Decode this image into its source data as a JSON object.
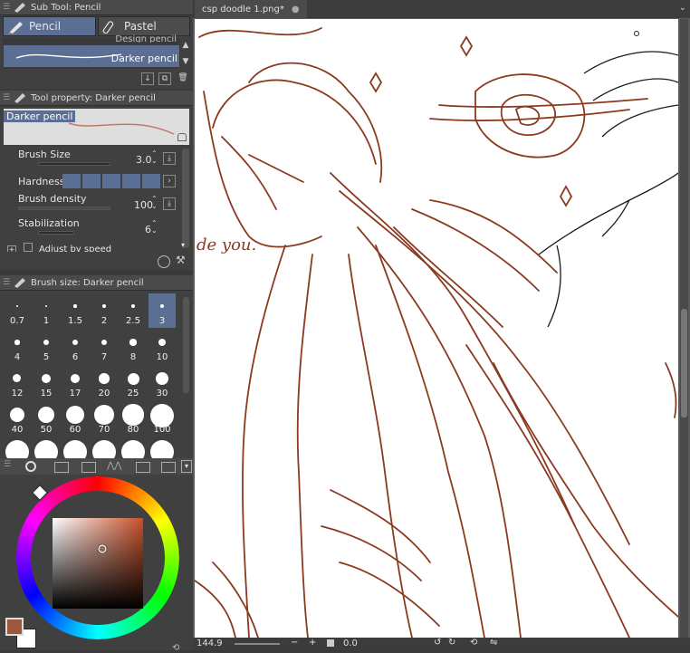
{
  "sub_tool": {
    "title": "Sub Tool: Pencil",
    "tabs": [
      "Pencil",
      "Pastel"
    ],
    "partial_item": "Design pencil",
    "selected_item": "Darker pencil"
  },
  "tool_property": {
    "title": "Tool property: Darker pencil",
    "preview_label": "Darker pencil",
    "brush_size_label": "Brush Size",
    "brush_size_value": "3.0",
    "hardness_label": "Hardness",
    "brush_density_label": "Brush density",
    "brush_density_value": "100",
    "stabilization_label": "Stabilization",
    "stabilization_value": "6",
    "adjust_label": "Adjust by speed"
  },
  "brush_size_panel": {
    "title": "Brush size: Darker pencil",
    "sizes": [
      "0.7",
      "1",
      "1.5",
      "2",
      "2.5",
      "3",
      "4",
      "5",
      "6",
      "7",
      "8",
      "10",
      "12",
      "15",
      "17",
      "20",
      "25",
      "30",
      "40",
      "50",
      "60",
      "70",
      "80",
      "100",
      "",
      "",
      "",
      "",
      "",
      ""
    ],
    "selected": "3"
  },
  "color": {
    "main_color": "#a0553e",
    "sub_color": "#ffffff",
    "picker_hue": "#c8502a"
  },
  "canvas": {
    "tab_title": "csp doodle 1.png*",
    "sketch_text": "de you.",
    "stroke_color": "#8b3a1f"
  },
  "status_bar": {
    "zoom": "144.9",
    "rotation": "0.0"
  }
}
